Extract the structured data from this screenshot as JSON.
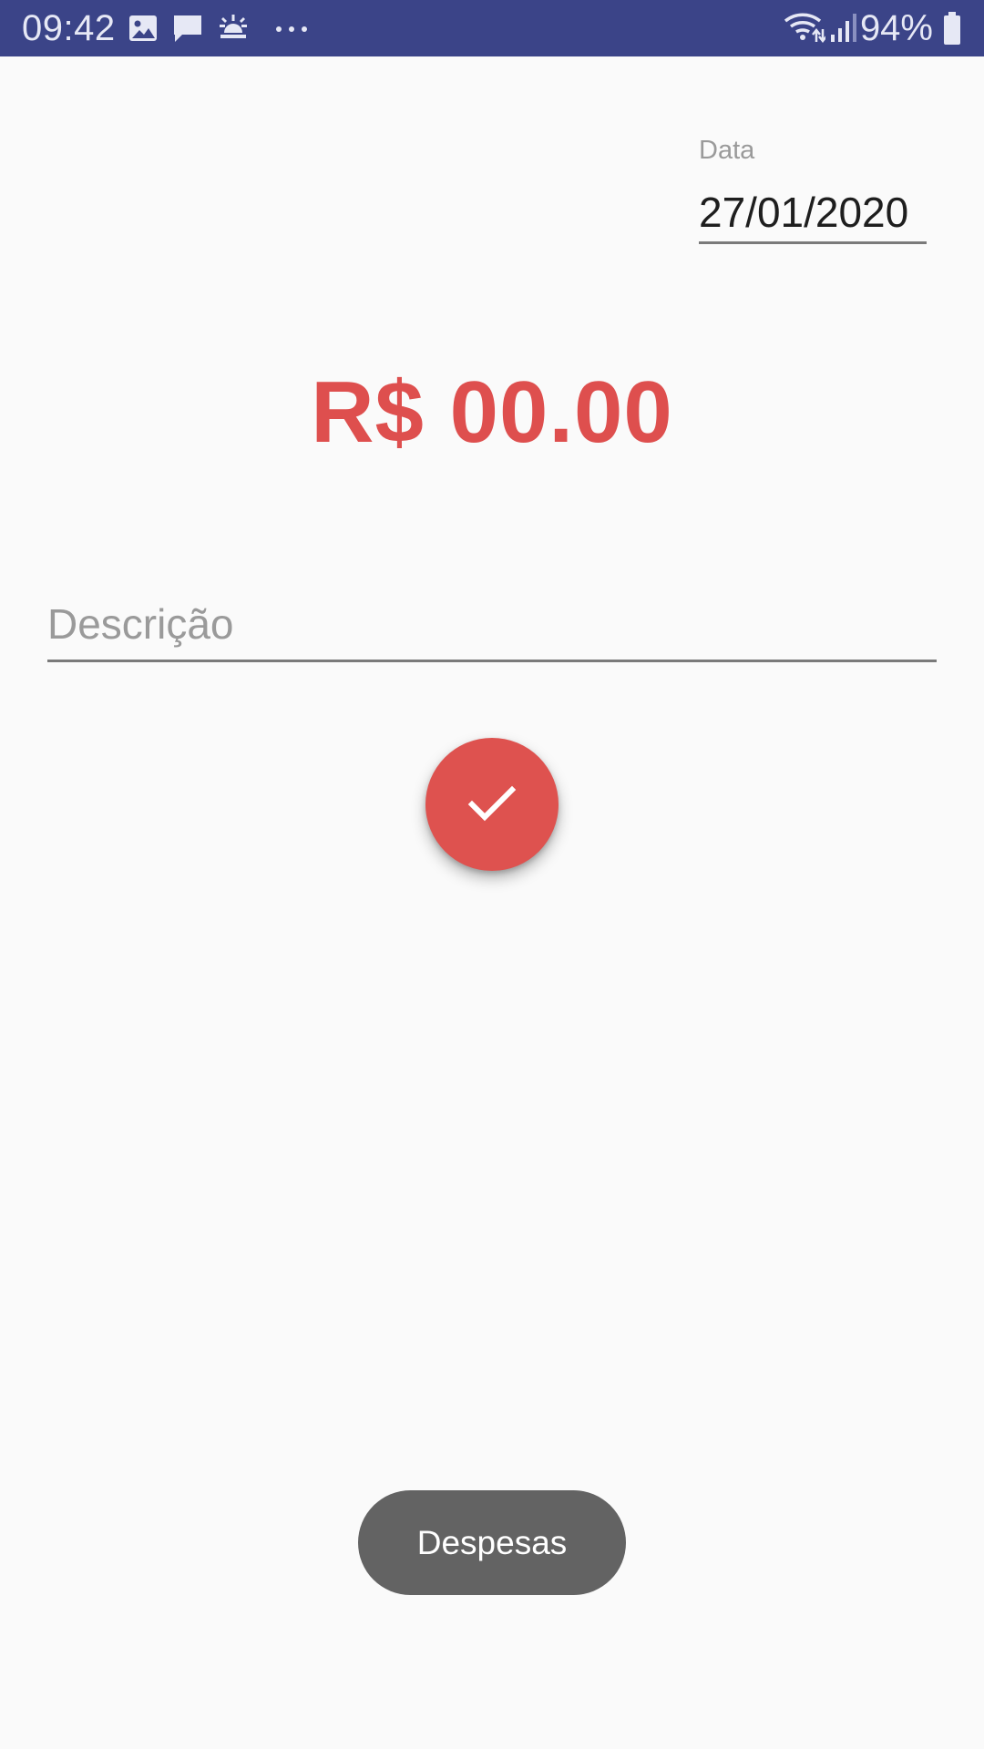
{
  "status_bar": {
    "time": "09:42",
    "left_icons": [
      "image-icon",
      "message-icon",
      "sunrise-icon",
      "more-dots-icon"
    ],
    "right_icons": [
      "wifi-icon",
      "signal-icon",
      "battery-icon"
    ],
    "battery": "94%",
    "background_color": "#3b4488"
  },
  "form": {
    "date_label": "Data",
    "date_value": "27/01/2020",
    "amount": "R$ 00.00",
    "amount_color": "#de4f4e",
    "description_placeholder": "Descrição",
    "confirm_icon": "check-icon",
    "fab_color": "#de524f"
  },
  "toast": {
    "text": "Despesas"
  }
}
